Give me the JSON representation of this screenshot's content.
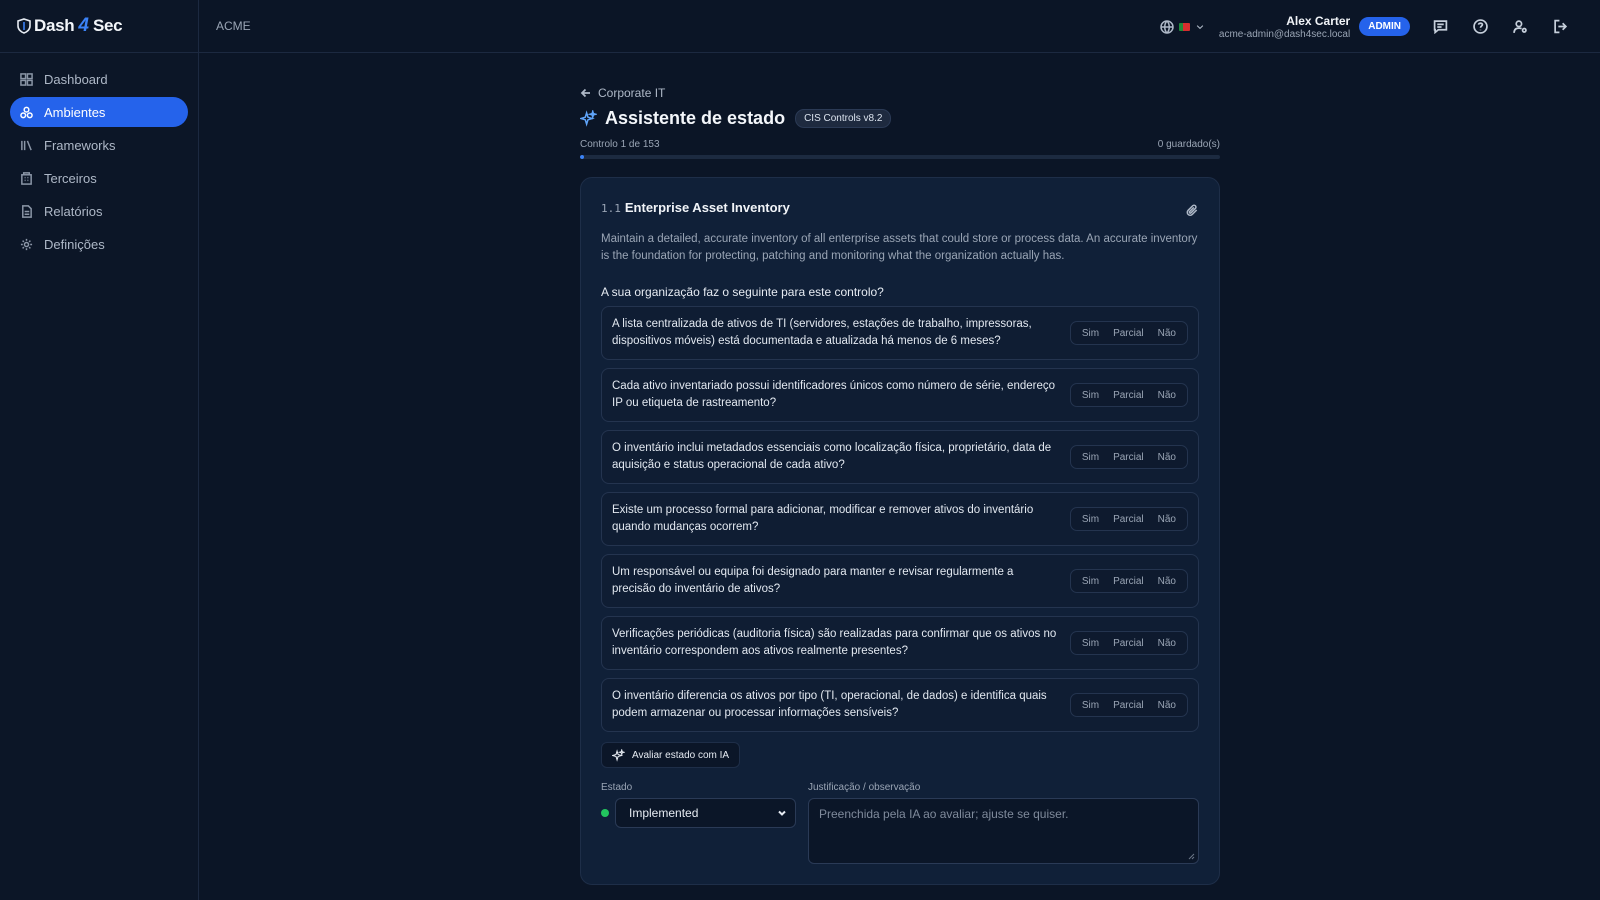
{
  "brand": {
    "part1": "Dash",
    "bolt": "4",
    "part2": "Sec"
  },
  "topbar": {
    "tenant": "ACME",
    "user_name": "Alex Carter",
    "user_email": "acme-admin@dash4sec.local",
    "role_badge": "ADMIN"
  },
  "sidebar": {
    "items": [
      {
        "label": "Dashboard",
        "icon": "dashboard-icon",
        "active": false
      },
      {
        "label": "Ambientes",
        "icon": "environments-icon",
        "active": true
      },
      {
        "label": "Frameworks",
        "icon": "library-icon",
        "active": false
      },
      {
        "label": "Terceiros",
        "icon": "building-icon",
        "active": false
      },
      {
        "label": "Relatórios",
        "icon": "report-icon",
        "active": false
      },
      {
        "label": "Definições",
        "icon": "gear-icon",
        "active": false
      }
    ]
  },
  "page": {
    "back_label": "Corporate IT",
    "title": "Assistente de estado",
    "framework_badge": "CIS Controls v8.2",
    "progress_text": "Controlo 1 de 153",
    "saved_text": "0 guardado(s)",
    "progress_fraction": 0.0065
  },
  "control": {
    "id": "1.1",
    "title": "Enterprise Asset Inventory",
    "description": "Maintain a detailed, accurate inventory of all enterprise assets that could store or process data. An accurate inventory is the foundation for protecting, patching and monitoring what the organization actually has.",
    "question_prompt": "A sua organização faz o seguinte para este controlo?",
    "options": [
      "Sim",
      "Parcial",
      "Não"
    ],
    "questions": [
      "A lista centralizada de ativos de TI (servidores, estações de trabalho, impressoras, dispositivos móveis) está documentada e atualizada há menos de 6 meses?",
      "Cada ativo inventariado possui identificadores únicos como número de série, endereço IP ou etiqueta de rastreamento?",
      "O inventário inclui metadados essenciais como localização física, proprietário, data de aquisição e status operacional de cada ativo?",
      "Existe um processo formal para adicionar, modificar e remover ativos do inventário quando mudanças ocorrem?",
      "Um responsável ou equipa foi designado para manter e revisar regularmente a precisão do inventário de ativos?",
      "Verificações periódicas (auditoria física) são realizadas para confirmar que os ativos no inventário correspondem aos ativos realmente presentes?",
      "O inventário diferencia os ativos por tipo (TI, operacional, de dados) e identifica quais podem armazenar ou processar informações sensíveis?"
    ],
    "ai_button": "Avaliar estado com IA",
    "estado_label": "Estado",
    "estado_value": "Implemented",
    "estado_color": "#22c55e",
    "justification_label": "Justificação / observação",
    "justification_placeholder": "Preenchida pela IA ao avaliar; ajuste se quiser."
  },
  "colors": {
    "accent": "#2563eb",
    "background": "#0b1526",
    "card": "#102038"
  }
}
